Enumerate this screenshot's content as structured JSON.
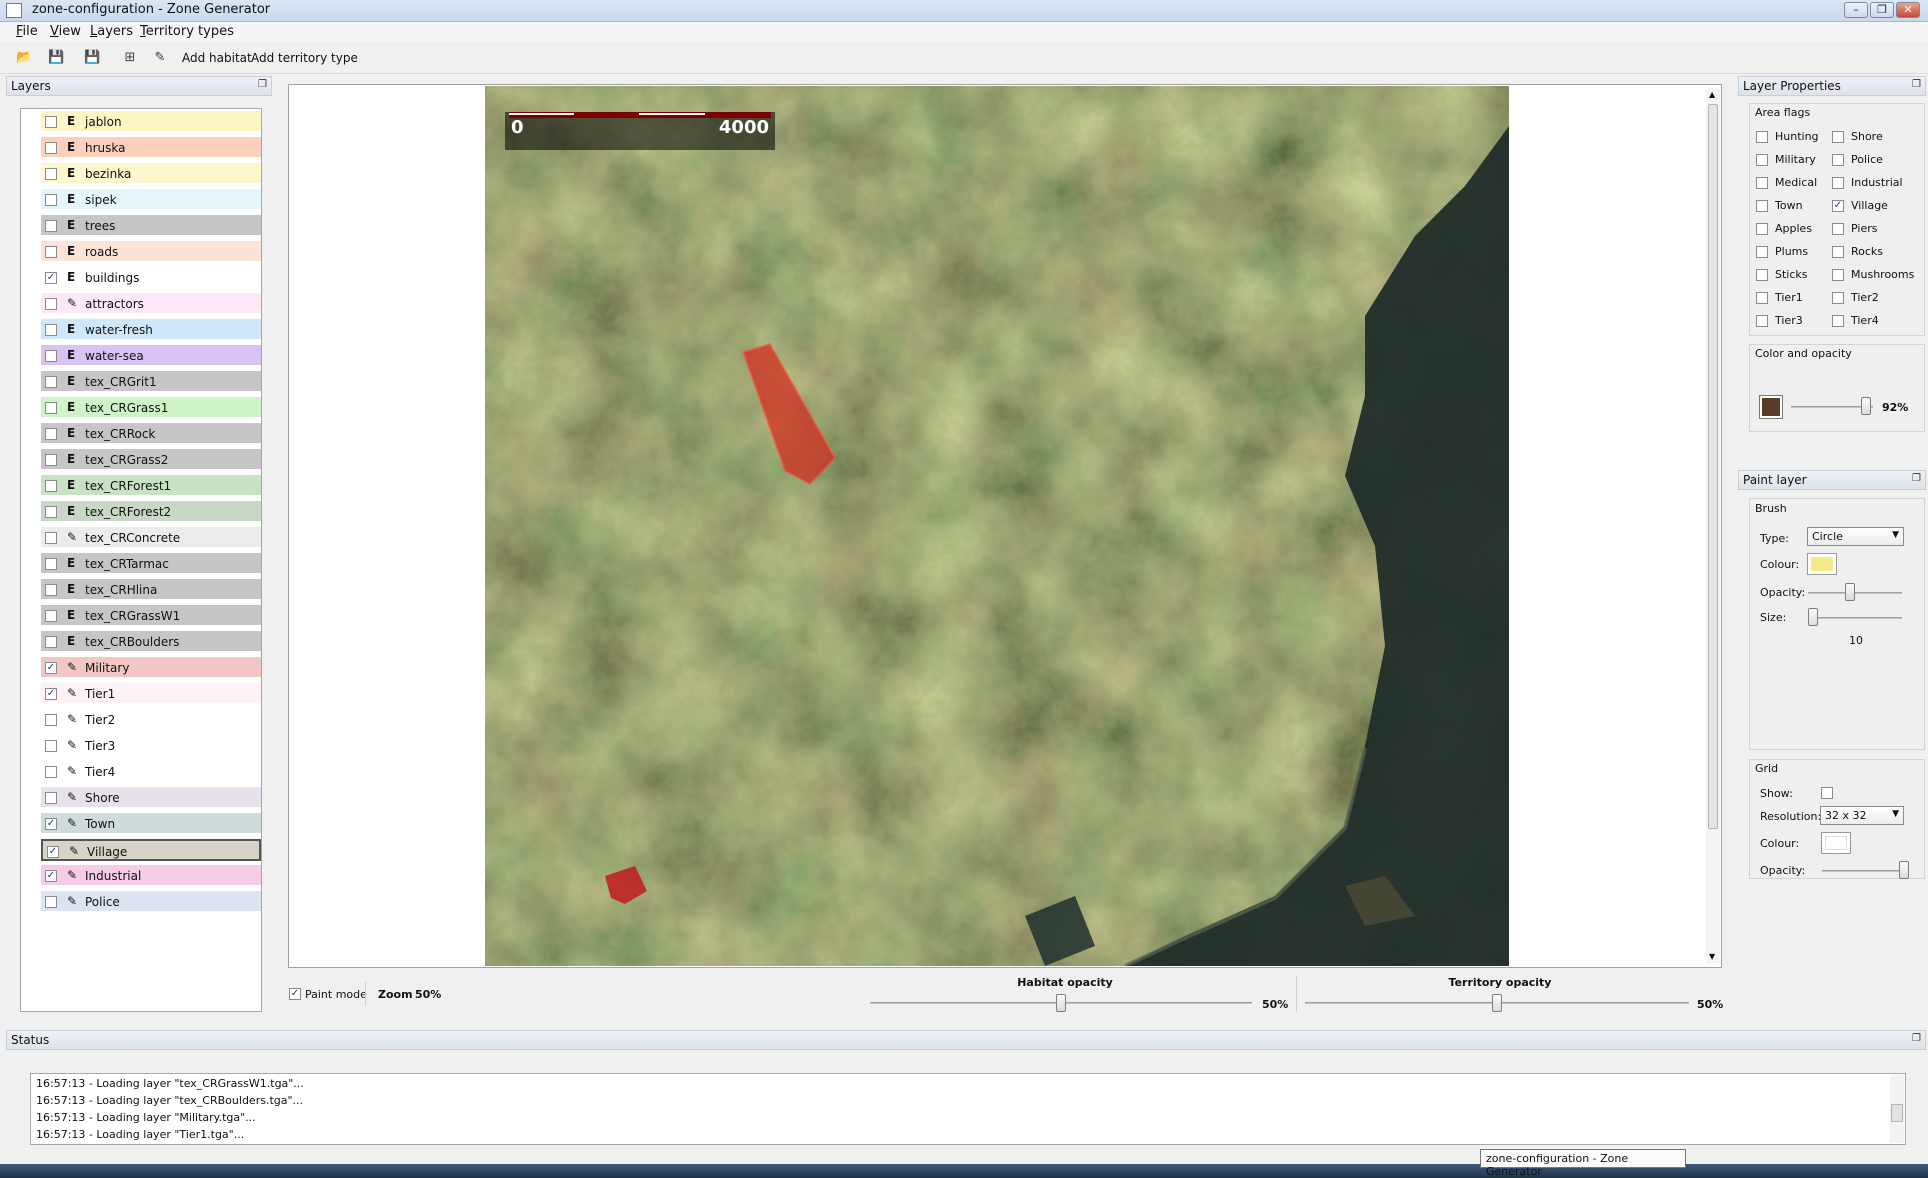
{
  "window": {
    "title": "zone-configuration - Zone Generator",
    "minimize": "–",
    "maximize": "❐",
    "close": "✕"
  },
  "menu": [
    {
      "label": "File"
    },
    {
      "label": "View"
    },
    {
      "label": "Layers"
    },
    {
      "label": "Territory types"
    }
  ],
  "toolbar": {
    "add_habitat": "Add habitat",
    "add_territory_type": "Add territory type"
  },
  "icons": {
    "open": "open-folder-icon",
    "save": "save-icon",
    "save_as": "save-as-icon",
    "select": "select-icon",
    "paint": "pencil-icon"
  },
  "layers_panel": {
    "title": "Layers",
    "items": [
      {
        "name": "jablon",
        "type": "E",
        "checked": false,
        "color": "#fcf6c5"
      },
      {
        "name": "hruska",
        "type": "E",
        "checked": false,
        "color": "#fbd0bd"
      },
      {
        "name": "bezinka",
        "type": "E",
        "checked": false,
        "color": "#fcf7cc"
      },
      {
        "name": "sipek",
        "type": "E",
        "checked": false,
        "color": "#e6f7fb"
      },
      {
        "name": "trees",
        "type": "E",
        "checked": false,
        "color": "#c6c6c6"
      },
      {
        "name": "roads",
        "type": "E",
        "checked": false,
        "color": "#fde3d7"
      },
      {
        "name": "buildings",
        "type": "E",
        "checked": true,
        "color": "#ffffff"
      },
      {
        "name": "attractors",
        "type": "✎",
        "checked": false,
        "color": "#fde9f7"
      },
      {
        "name": "water-fresh",
        "type": "E",
        "checked": false,
        "color": "#cfe7fa"
      },
      {
        "name": "water-sea",
        "type": "E",
        "checked": false,
        "color": "#d9c3f4"
      },
      {
        "name": "tex_CRGrit1",
        "type": "E",
        "checked": false,
        "color": "#c6c6c6"
      },
      {
        "name": "tex_CRGrass1",
        "type": "E",
        "checked": false,
        "color": "#cdf3c6"
      },
      {
        "name": "tex_CRRock",
        "type": "E",
        "checked": false,
        "color": "#c6c6c6"
      },
      {
        "name": "tex_CRGrass2",
        "type": "E",
        "checked": false,
        "color": "#c6c6c6"
      },
      {
        "name": "tex_CRForest1",
        "type": "E",
        "checked": false,
        "color": "#c7e3c4"
      },
      {
        "name": "tex_CRForest2",
        "type": "E",
        "checked": false,
        "color": "#c9d8c6"
      },
      {
        "name": "tex_CRConcrete",
        "type": "✎",
        "checked": false,
        "color": "#ececec"
      },
      {
        "name": "tex_CRTarmac",
        "type": "E",
        "checked": false,
        "color": "#c6c6c6"
      },
      {
        "name": "tex_CRHlina",
        "type": "E",
        "checked": false,
        "color": "#c6c6c6"
      },
      {
        "name": "tex_CRGrassW1",
        "type": "E",
        "checked": false,
        "color": "#c6c6c6"
      },
      {
        "name": "tex_CRBoulders",
        "type": "E",
        "checked": false,
        "color": "#c6c6c6"
      },
      {
        "name": "Military",
        "type": "✎",
        "checked": true,
        "color": "#f3c6c6"
      },
      {
        "name": "Tier1",
        "type": "✎",
        "checked": true,
        "color": "#fdf2f5"
      },
      {
        "name": "Tier2",
        "type": "✎",
        "checked": false,
        "color": "#ffffff"
      },
      {
        "name": "Tier3",
        "type": "✎",
        "checked": false,
        "color": "#ffffff"
      },
      {
        "name": "Tier4",
        "type": "✎",
        "checked": false,
        "color": "#ffffff"
      },
      {
        "name": "Shore",
        "type": "✎",
        "checked": false,
        "color": "#e6e1ea"
      },
      {
        "name": "Town",
        "type": "✎",
        "checked": true,
        "color": "#cfdada"
      },
      {
        "name": "Village",
        "type": "✎",
        "checked": true,
        "color": "#d9d2c6",
        "selected": true
      },
      {
        "name": "Industrial",
        "type": "✎",
        "checked": true,
        "color": "#f6cce6"
      },
      {
        "name": "Police",
        "type": "✎",
        "checked": false,
        "color": "#dce3f1"
      }
    ]
  },
  "map": {
    "scale_start": "0",
    "scale_end": "4000",
    "paint_mode_label": "Paint mode",
    "paint_mode_checked": true,
    "zoom_label": "Zoom",
    "zoom_value": "50%",
    "habitat_opacity_label": "Habitat opacity",
    "habitat_opacity_value": "50%",
    "habitat_opacity": 0.5,
    "territory_opacity_label": "Territory opacity",
    "territory_opacity_value": "50%",
    "territory_opacity": 0.5
  },
  "layer_properties": {
    "title": "Layer Properties",
    "area_flags_title": "Area flags",
    "flags": [
      {
        "label": "Hunting",
        "checked": false
      },
      {
        "label": "Shore",
        "checked": false
      },
      {
        "label": "Military",
        "checked": false
      },
      {
        "label": "Police",
        "checked": false
      },
      {
        "label": "Medical",
        "checked": false
      },
      {
        "label": "Industrial",
        "checked": false
      },
      {
        "label": "Town",
        "checked": false
      },
      {
        "label": "Village",
        "checked": true
      },
      {
        "label": "Apples",
        "checked": false
      },
      {
        "label": "Piers",
        "checked": false
      },
      {
        "label": "Plums",
        "checked": false
      },
      {
        "label": "Rocks",
        "checked": false
      },
      {
        "label": "Sticks",
        "checked": false
      },
      {
        "label": "Mushrooms",
        "checked": false
      },
      {
        "label": "Tier1",
        "checked": false
      },
      {
        "label": "Tier2",
        "checked": false
      },
      {
        "label": "Tier3",
        "checked": false
      },
      {
        "label": "Tier4",
        "checked": false
      }
    ],
    "color_opacity_title": "Color and opacity",
    "color": "#5a3c28",
    "opacity_value": "92%",
    "opacity": 0.92
  },
  "paint_layer": {
    "title": "Paint layer",
    "brush_title": "Brush",
    "type_label": "Type:",
    "type_value": "Circle",
    "colour_label": "Colour:",
    "colour": "#f3ea8a",
    "opacity_label": "Opacity:",
    "opacity": 0.45,
    "size_label": "Size:",
    "size_value": "10",
    "size_fraction": 0.05,
    "grid_title": "Grid",
    "show_label": "Show:",
    "show_checked": false,
    "resolution_label": "Resolution:",
    "resolution_value": "32 x 32",
    "grid_colour_label": "Colour:",
    "grid_colour": "#ffffff",
    "grid_opacity_label": "Opacity:",
    "grid_opacity": 1.0
  },
  "status": {
    "title": "Status",
    "lines": [
      "16:57:13 - Loading layer \"tex_CRGrassW1.tga\"...",
      "16:57:13 - Loading layer \"tex_CRBoulders.tga\"...",
      "16:57:13 - Loading layer \"Military.tga\"...",
      "16:57:13 - Loading layer \"Tier1.tga\"..."
    ]
  },
  "tooltip": "zone-configuration - Zone Generator"
}
